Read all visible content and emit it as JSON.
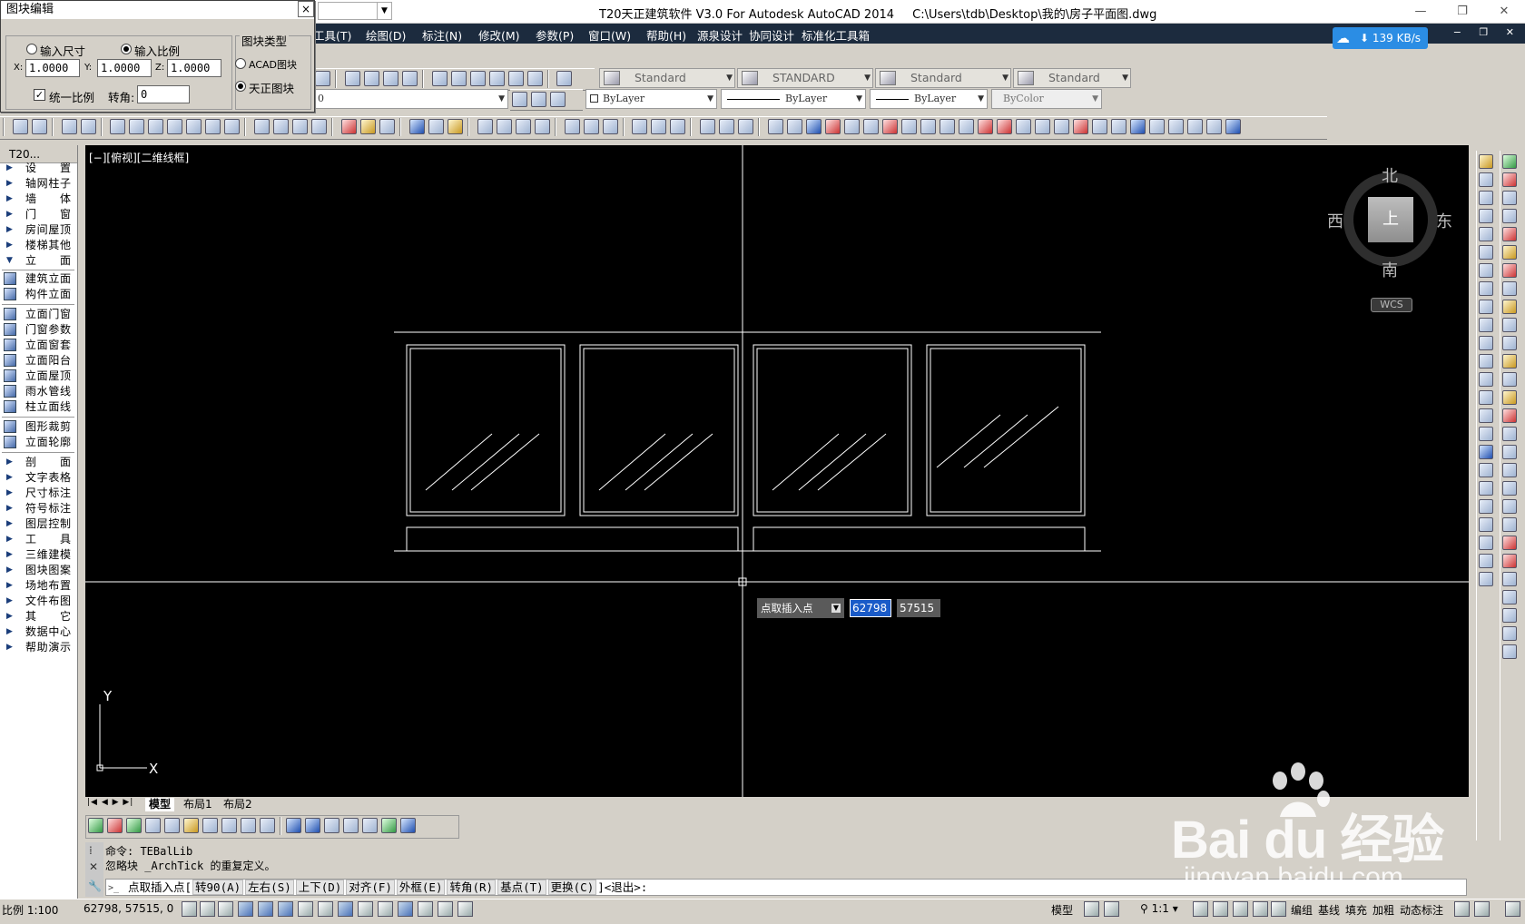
{
  "window": {
    "title": "T20天正建筑软件 V3.0 For Autodesk AutoCAD 2014",
    "file_path": "C:\\Users\\tdb\\Desktop\\我的\\房子平面图.dwg"
  },
  "menu": [
    "工具(T)",
    "绘图(D)",
    "标注(N)",
    "修改(M)",
    "参数(P)",
    "窗口(W)",
    "帮助(H)",
    "源泉设计",
    "协同设计",
    "标准化工具箱"
  ],
  "net_speed": "139 KB/s",
  "styles": {
    "text_style": "Standard",
    "dim_style": "STANDARD",
    "table_style": "Standard",
    "multileader_style": "Standard"
  },
  "layer": {
    "current": "0",
    "color": "ByLayer",
    "linetype": "ByLayer",
    "lineweight": "ByLayer",
    "plotstyle": "ByColor"
  },
  "dialog": {
    "title": "图块编辑",
    "close": "×",
    "radio_size": "输入尺寸",
    "radio_scale": "输入比例",
    "x_label": "X:",
    "x_value": "1.0000",
    "y_label": "Y:",
    "y_value": "1.0000",
    "z_label": "Z:",
    "z_value": "1.0000",
    "uniform_label": "统一比例",
    "rotation_label": "转角:",
    "rotation_value": "0",
    "block_type_title": "图块类型",
    "acad_block": "ACAD图块",
    "tz_block": "天正图块"
  },
  "sidebar": {
    "header": "T20...",
    "items": [
      "设　　置",
      "轴网柱子",
      "墙　　体",
      "门　　窗",
      "房间屋顶",
      "楼梯其他",
      "立　　面",
      "建筑立面",
      "构件立面",
      "立面门窗",
      "门窗参数",
      "立面窗套",
      "立面阳台",
      "立面屋顶",
      "雨水管线",
      "柱立面线",
      "图形裁剪",
      "立面轮廓",
      "剖　　面",
      "文字表格",
      "尺寸标注",
      "符号标注",
      "图层控制",
      "工　　具",
      "三维建模",
      "图块图案",
      "场地布置",
      "文件布图",
      "其　　它",
      "数据中心",
      "帮助演示"
    ]
  },
  "viewport": {
    "label": "[−][俯视][二维线框]",
    "nav": {
      "north": "北",
      "south": "南",
      "east": "东",
      "west": "西",
      "top": "上"
    },
    "wcs": "WCS",
    "axis_x": "X",
    "axis_y": "Y",
    "dynamic_prompt": "点取插入点",
    "dyn_x": "62798",
    "dyn_y": "57515"
  },
  "layout_tabs": [
    "模型",
    "布局1",
    "布局2"
  ],
  "command": {
    "history": [
      "命令: TEBalLib",
      "忽略块 _ArchTick 的重复定义。"
    ],
    "prompt": "点取插入点[",
    "options": [
      "转90(A)",
      "左右(S)",
      "上下(D)",
      "对齐(F)",
      "外框(E)",
      "转角(R)",
      "基点(T)",
      "更换(C)"
    ],
    "suffix": "]<退出>:"
  },
  "statusbar": {
    "scale": "比例 1:100",
    "coords": "62798, 57515, 0",
    "model": "模型",
    "anno_scale": "1:1",
    "right_items": [
      "编组",
      "基线",
      "填充",
      "加粗",
      "动态标注"
    ]
  },
  "watermark": {
    "brand": "Bai du 经验",
    "url": "jingyan.baidu.com"
  }
}
